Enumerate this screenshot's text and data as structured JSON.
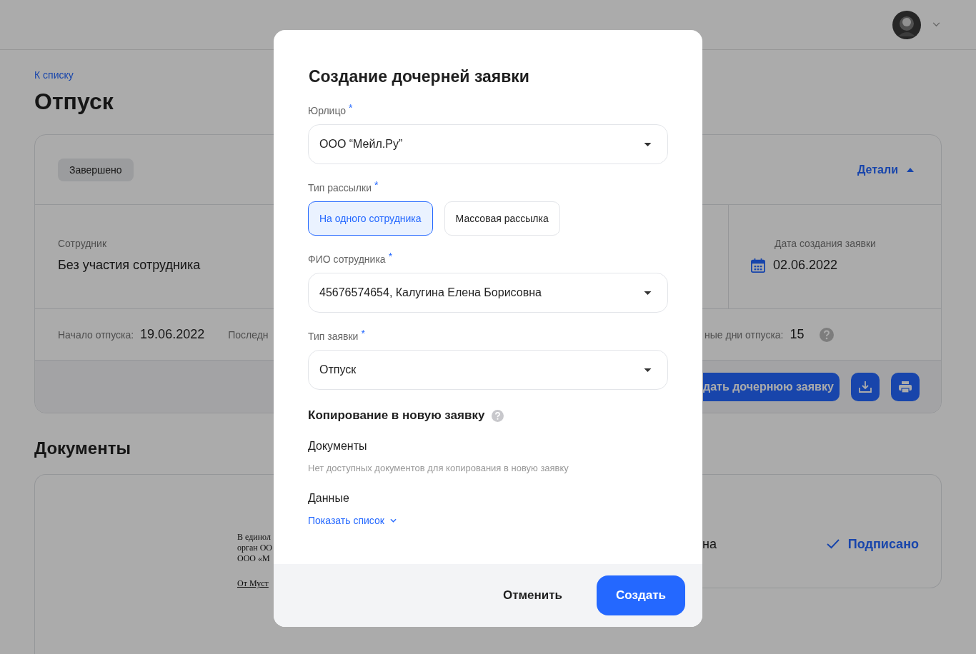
{
  "page": {
    "back_link": "К списку",
    "title": "Отпуск"
  },
  "request_card": {
    "status": "Завершено",
    "details_toggle": {
      "label": "Детали",
      "expanded": true
    },
    "employee": {
      "label": "Сотрудник",
      "value": "Без участия сотрудника"
    },
    "created": {
      "label": "Дата создания заявки",
      "value": "02.06.2022"
    },
    "vacation_start": {
      "label": "Начало отпуска:",
      "value": "19.06.2022"
    },
    "column_3_label": "Последн",
    "vacation_days": {
      "label": "ные дни отпуска:",
      "value": "15"
    },
    "create_child_button": "дать дочернюю заявку"
  },
  "documents": {
    "title": "Документы",
    "preview_lines": [
      "В единол",
      "орган ОО",
      "ООО «М"
    ],
    "preview_signature": "От Муст",
    "signer": "на",
    "status": "Подписано"
  },
  "dialog": {
    "title": "Создание дочерней заявки",
    "fields": [
      {
        "kind": "select",
        "label": "Юрлицо",
        "required_mark": "*",
        "value": "ООО “Мейл.Ру”"
      },
      {
        "kind": "choice",
        "label": "Тип рассылки",
        "required_mark": "*",
        "options": [
          {
            "label": "На одного сотрудника",
            "selected": true
          },
          {
            "label": "Массовая рассылка",
            "selected": false
          }
        ]
      },
      {
        "kind": "select",
        "label": "ФИО сотрудника",
        "required_mark": "*",
        "value": "45676574654, Калугина Елена Борисовна"
      },
      {
        "kind": "select",
        "label": "Тип заявки",
        "required_mark": "*",
        "value": "Отпуск"
      }
    ],
    "copy_section": {
      "title": "Копирование в новую заявку",
      "documents_title": "Документы",
      "documents_note": "Нет доступных документов для копирования в новую заявку",
      "data_title": "Данные",
      "data_toggle": {
        "label": "Показать список",
        "expanded": false
      }
    },
    "cancel_button": "Отменить",
    "submit_button": "Создать"
  }
}
